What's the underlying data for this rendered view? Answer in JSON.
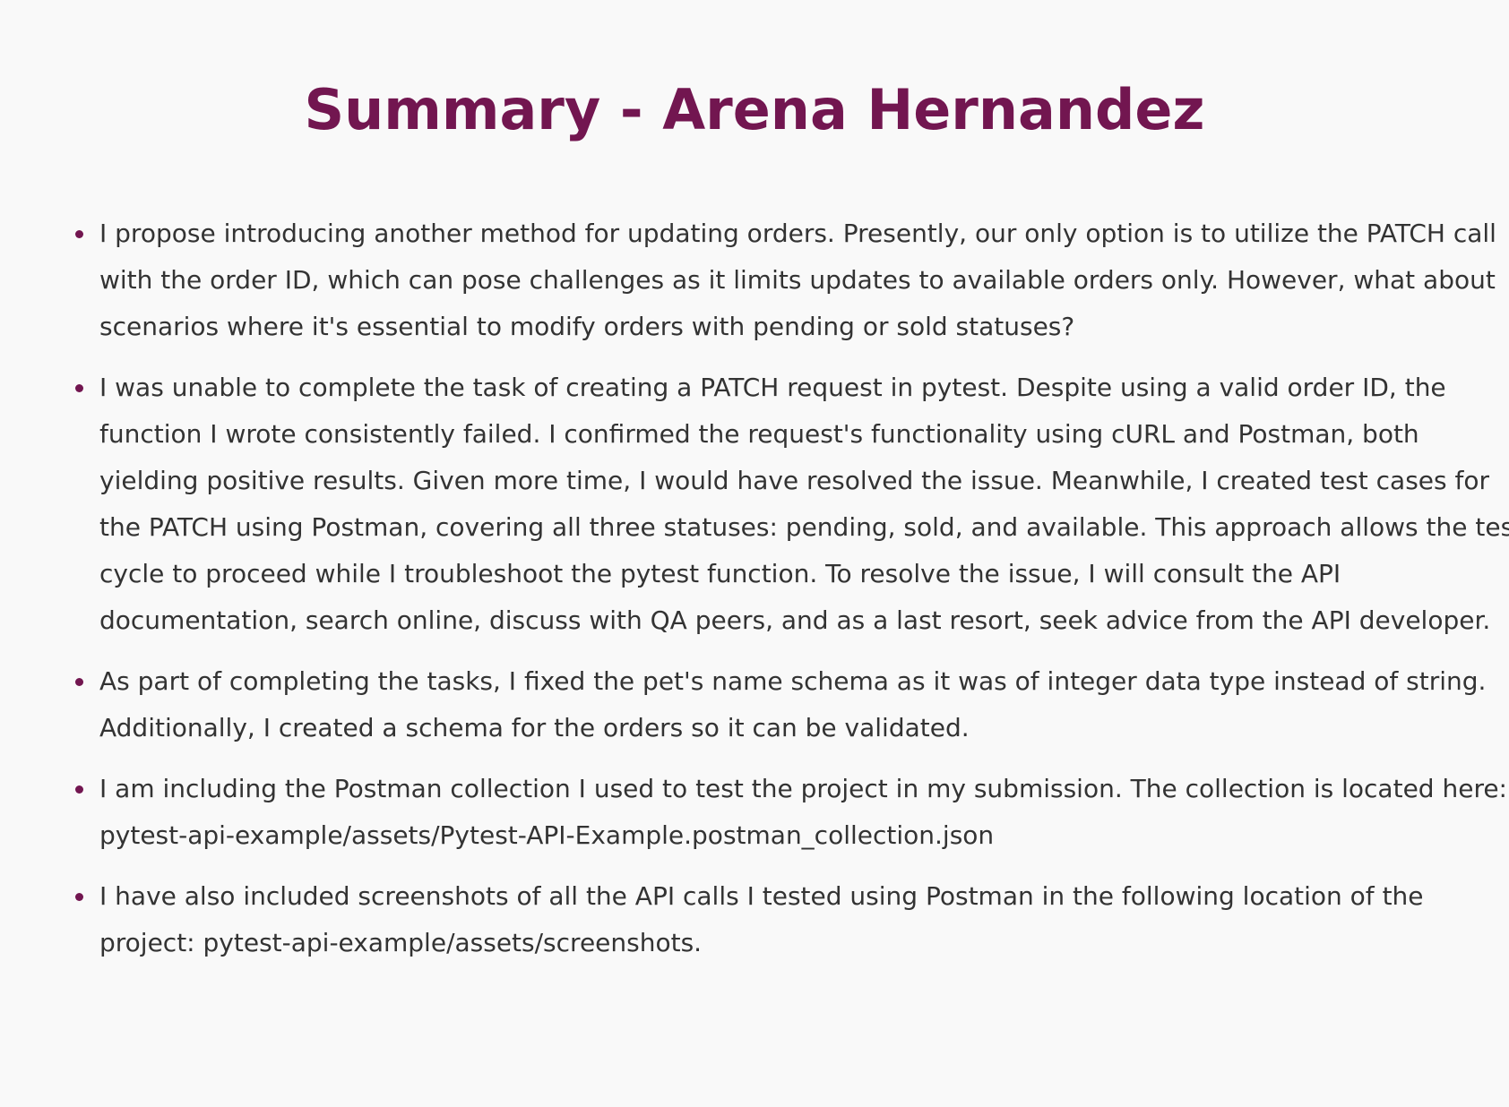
{
  "page": {
    "title": "Summary - Arena Hernandez"
  },
  "colors": {
    "accent": "#721650",
    "text": "#333333",
    "background": "#f9f9f9"
  },
  "items": [
    {
      "text": "I propose introducing another method for updating orders. Presently, our only option is to utilize the PATCH call with the order ID, which can pose challenges as it limits updates to available orders only. However, what about scenarios where it's essential to modify orders with pending or sold statuses?"
    },
    {
      "text": "I was unable to complete the task of creating a PATCH request in pytest. Despite using a valid order ID, the function I wrote consistently failed. I confirmed the request's functionality using cURL and Postman, both yielding positive results. Given more time, I would have resolved the issue. Meanwhile, I created test cases for the PATCH using Postman, covering all three statuses: pending, sold, and available. This approach allows the test cycle to proceed while I troubleshoot the pytest function. To resolve the issue, I will consult the API documentation, search online, discuss with QA peers, and as a last resort, seek advice from the API developer."
    },
    {
      "text": "As part of completing the tasks, I fixed the pet's name schema as it was of integer data type instead of string. Additionally, I created a schema for the orders so it can be validated."
    },
    {
      "text": "I am including the Postman collection I used to test the project in my submission. The collection is located here: pytest-api-example/assets/Pytest-API-Example.postman_collection.json"
    },
    {
      "text": "I have also included screenshots of all the API calls I tested using Postman in the following location of the project: pytest-api-example/assets/screenshots."
    }
  ]
}
